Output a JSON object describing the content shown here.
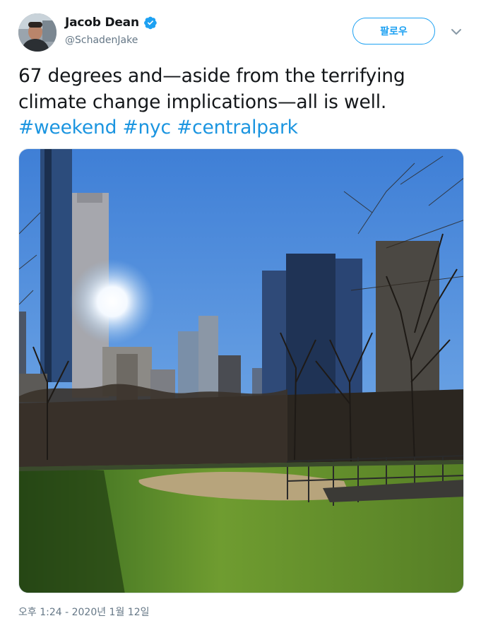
{
  "author": {
    "display_name": "Jacob Dean",
    "handle": "@SchadenJake",
    "verified": true,
    "avatar_icon": "user-avatar"
  },
  "actions": {
    "follow_label": "팔로우",
    "more_icon": "chevron-down-icon"
  },
  "tweet": {
    "text_line1": "67 degrees and—aside from the terrifying",
    "text_line2": "climate change implications—all is well.",
    "hashtags": [
      "#weekend",
      "#nyc",
      "#centralpark"
    ],
    "timestamp": "오후 1:24 - 2020년 1월 12일"
  },
  "media": {
    "type": "photo"
  },
  "colors": {
    "accent": "#1da1f2",
    "hashtag": "#1b95e0",
    "secondary_text": "#657786"
  }
}
